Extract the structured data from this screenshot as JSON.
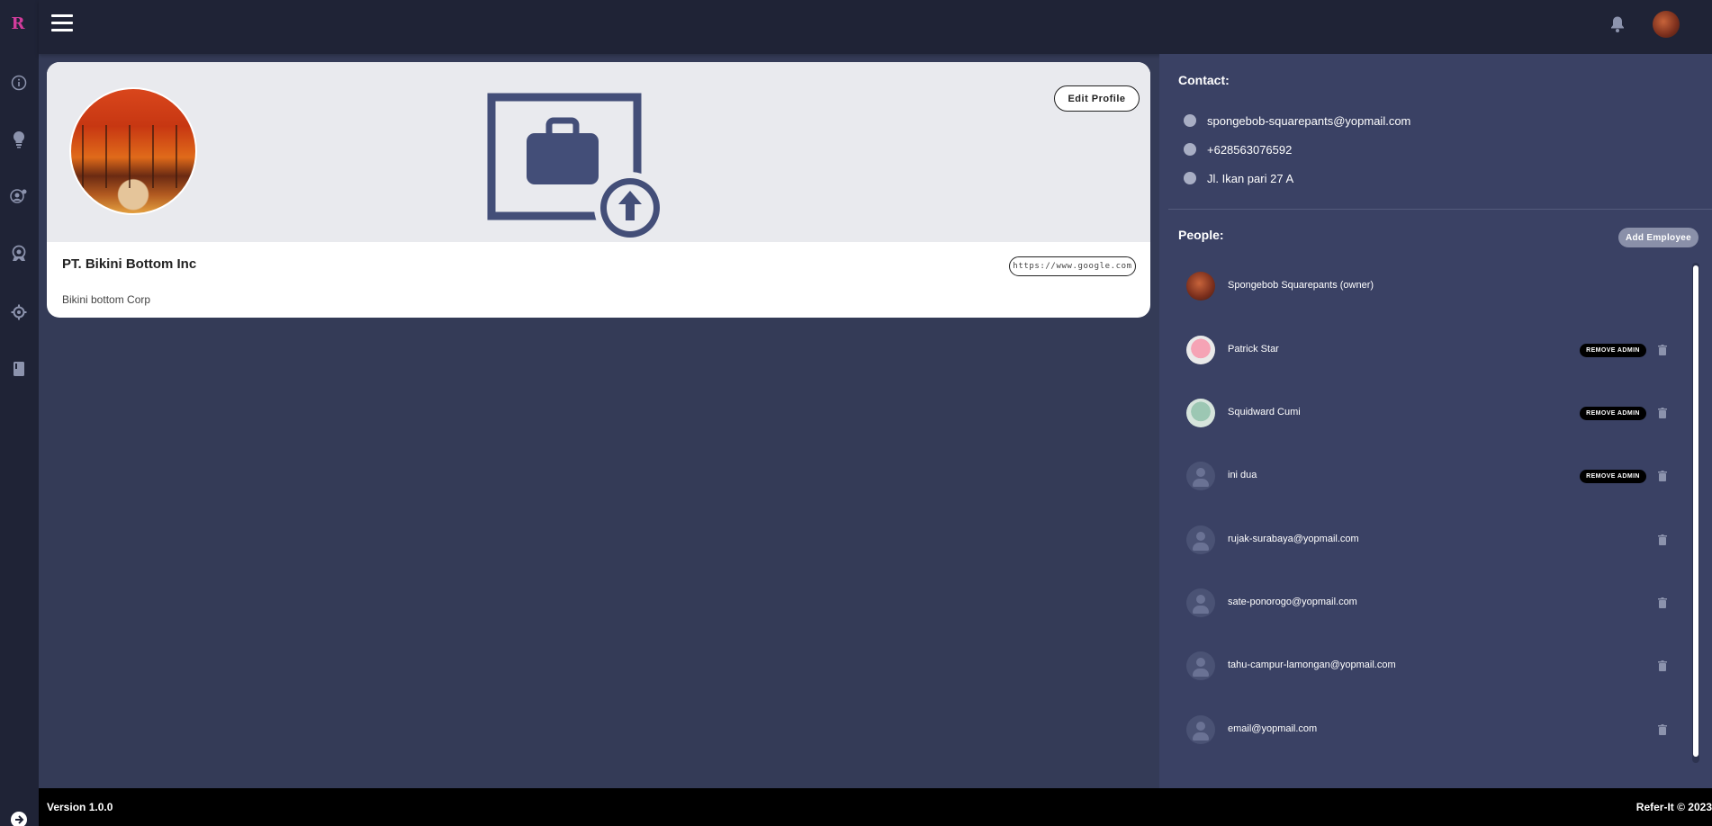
{
  "app": {
    "logo_text": "R"
  },
  "sidebar": {
    "icons": [
      "info-icon",
      "lightbulb-icon",
      "user-settings-icon",
      "award-icon",
      "gear-icon",
      "book-icon"
    ],
    "logout_icon": "logout-icon"
  },
  "topbar": {
    "menu_icon": "hamburger-icon",
    "bell_icon": "bell-icon"
  },
  "profile": {
    "edit_label": "Edit Profile",
    "name": "PT. Bikini Bottom Inc",
    "website": "https://www.google.com",
    "description": "Bikini bottom Corp"
  },
  "contact": {
    "title": "Contact:",
    "email": "spongebob-squarepants@yopmail.com",
    "phone": "+628563076592",
    "address": "Jl. Ikan pari 27 A"
  },
  "people": {
    "title": "People:",
    "add_label": "Add Employee",
    "remove_admin_label": "REMOVE ADMIN",
    "members": [
      {
        "name": "Spongebob Squarepants (owner)",
        "admin": false,
        "deletable": false
      },
      {
        "name": "Patrick Star",
        "admin": true,
        "deletable": true
      },
      {
        "name": "Squidward Cumi",
        "admin": true,
        "deletable": true
      },
      {
        "name": "ini dua",
        "admin": true,
        "deletable": true
      },
      {
        "name": "rujak-surabaya@yopmail.com",
        "admin": false,
        "deletable": true
      },
      {
        "name": "sate-ponorogo@yopmail.com",
        "admin": false,
        "deletable": true
      },
      {
        "name": "tahu-campur-lamongan@yopmail.com",
        "admin": false,
        "deletable": true
      },
      {
        "name": "email@yopmail.com",
        "admin": false,
        "deletable": true
      }
    ]
  },
  "footer": {
    "version": "Version 1.0.0",
    "copyright": "Refer-It © 2023"
  },
  "colors": {
    "rail": "#1f2336",
    "panel": "#3a4164",
    "content": "#343b57",
    "accent": "#d23c9c"
  }
}
